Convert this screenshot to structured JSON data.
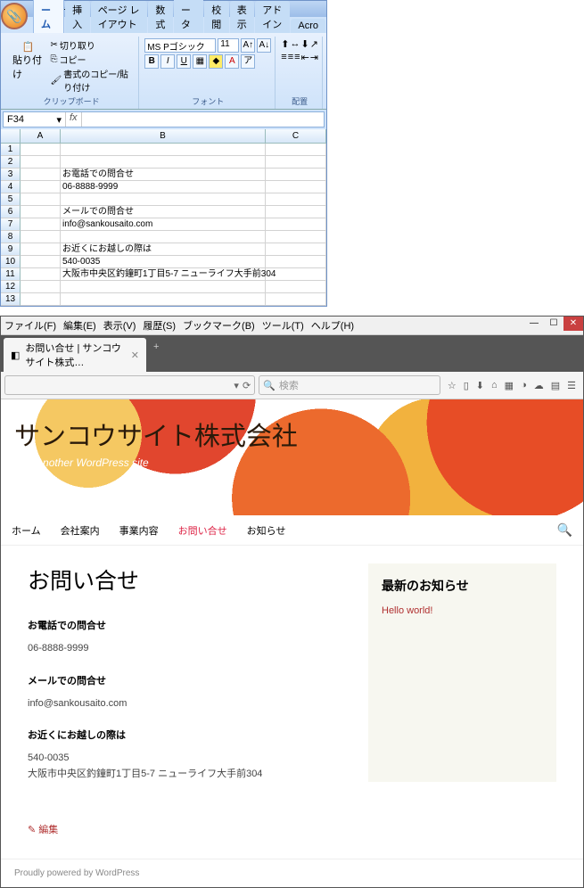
{
  "excel": {
    "tabs": [
      "ホーム",
      "挿入",
      "ページ レイアウト",
      "数式",
      "データ",
      "校閲",
      "表示",
      "アドイン",
      "Acro"
    ],
    "active_tab": "ホーム",
    "clipboard": {
      "paste": "貼り付け",
      "cut": "切り取り",
      "copy": "コピー",
      "format_painter": "書式のコピー/貼り付け",
      "group": "クリップボード"
    },
    "font": {
      "name": "MS Pゴシック",
      "size": "11",
      "group": "フォント"
    },
    "align_group": "配置",
    "name_box": "F34",
    "columns": [
      "A",
      "B",
      "C"
    ],
    "rows": [
      {
        "n": "1",
        "A": "",
        "B": ""
      },
      {
        "n": "2",
        "A": "",
        "B": ""
      },
      {
        "n": "3",
        "A": "",
        "B": "お電話での問合せ"
      },
      {
        "n": "4",
        "A": "",
        "B": "06-8888-9999"
      },
      {
        "n": "5",
        "A": "",
        "B": ""
      },
      {
        "n": "6",
        "A": "",
        "B": "メールでの問合せ"
      },
      {
        "n": "7",
        "A": "",
        "B": "info@sankousaito.com"
      },
      {
        "n": "8",
        "A": "",
        "B": ""
      },
      {
        "n": "9",
        "A": "",
        "B": "お近くにお越しの際は"
      },
      {
        "n": "10",
        "A": "",
        "B": "540-0035"
      },
      {
        "n": "11",
        "A": "",
        "B": "大阪市中央区釣鐘町1丁目5-7 ニューライフ大手前304"
      },
      {
        "n": "12",
        "A": "",
        "B": ""
      },
      {
        "n": "13",
        "A": "",
        "B": ""
      }
    ]
  },
  "firefox": {
    "menus": [
      "ファイル(F)",
      "編集(E)",
      "表示(V)",
      "履歴(S)",
      "ブックマーク(B)",
      "ツール(T)",
      "ヘルプ(H)"
    ],
    "tab_title": "お問い合せ | サンコウサイト株式…",
    "search_placeholder": "検索",
    "site_title": "サンコウサイト株式会社",
    "tagline": "Just another WordPress site",
    "nav": [
      "ホーム",
      "会社案内",
      "事業内容",
      "お問い合せ",
      "お知らせ"
    ],
    "nav_active": "お問い合せ",
    "page_title": "お問い合せ",
    "sections": [
      {
        "h": "お電話での問合せ",
        "p": [
          "06-8888-9999"
        ]
      },
      {
        "h": "メールでの問合せ",
        "p": [
          "info@sankousaito.com"
        ]
      },
      {
        "h": "お近くにお越しの際は",
        "p": [
          "540-0035",
          "大阪市中央区釣鐘町1丁目5-7 ニューライフ大手前304"
        ]
      }
    ],
    "sidebar_title": "最新のお知らせ",
    "sidebar_link": "Hello world!",
    "edit": "編集",
    "footer": "Proudly powered by WordPress"
  }
}
